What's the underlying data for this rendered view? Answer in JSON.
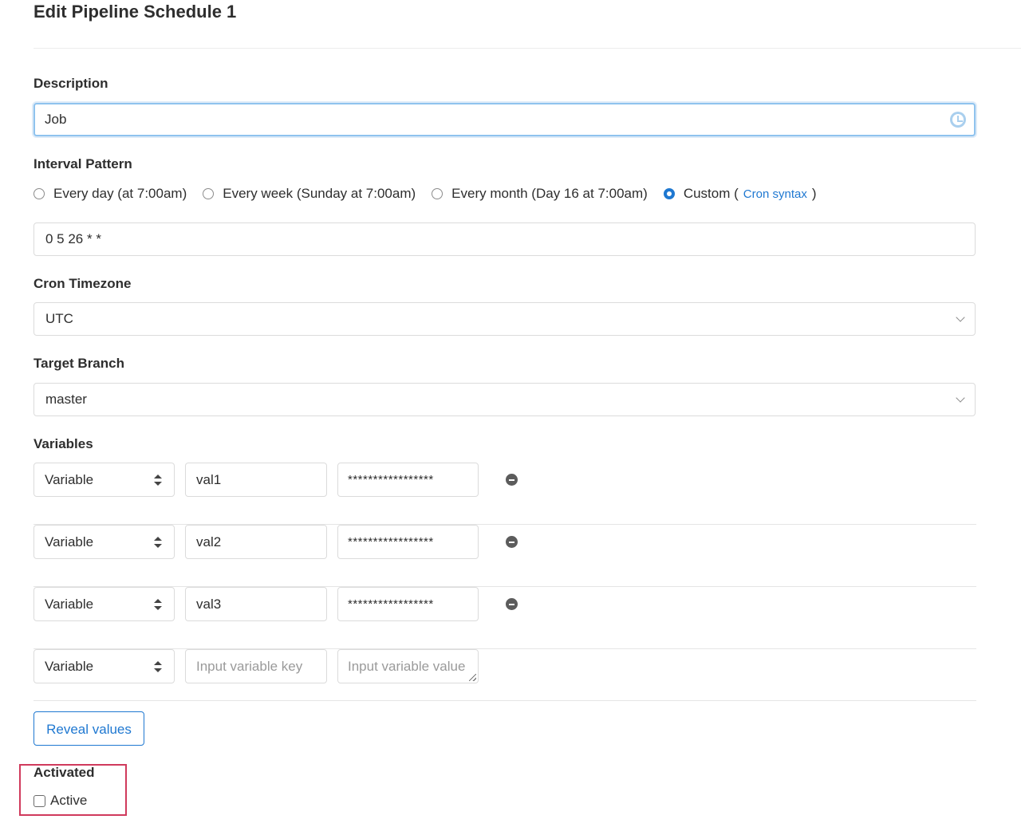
{
  "page": {
    "title": "Edit Pipeline Schedule 1"
  },
  "description": {
    "label": "Description",
    "value": "Job"
  },
  "interval": {
    "label": "Interval Pattern",
    "options": [
      {
        "label": "Every day (at 7:00am)",
        "checked": false
      },
      {
        "label": "Every week (Sunday at 7:00am)",
        "checked": false
      },
      {
        "label": "Every month (Day 16 at 7:00am)",
        "checked": false
      },
      {
        "label": "Custom (",
        "checked": true
      }
    ],
    "cron_link": "Cron syntax",
    "close_paren": ")",
    "cron_value": "0 5 26 * *"
  },
  "timezone": {
    "label": "Cron Timezone",
    "value": "UTC"
  },
  "branch": {
    "label": "Target Branch",
    "value": "master"
  },
  "variables": {
    "label": "Variables",
    "rows": [
      {
        "type": "Variable",
        "key": "val1",
        "value": "*****************"
      },
      {
        "type": "Variable",
        "key": "val2",
        "value": "*****************"
      },
      {
        "type": "Variable",
        "key": "val3",
        "value": "*****************"
      }
    ],
    "new_row": {
      "type": "Variable",
      "key_placeholder": "Input variable key",
      "value_placeholder": "Input variable value"
    },
    "reveal_label": "Reveal values"
  },
  "activated": {
    "label": "Activated",
    "checkbox_label": "Active",
    "checked": false
  },
  "colors": {
    "accent": "#1f78d1",
    "highlight": "#d03a5c"
  }
}
